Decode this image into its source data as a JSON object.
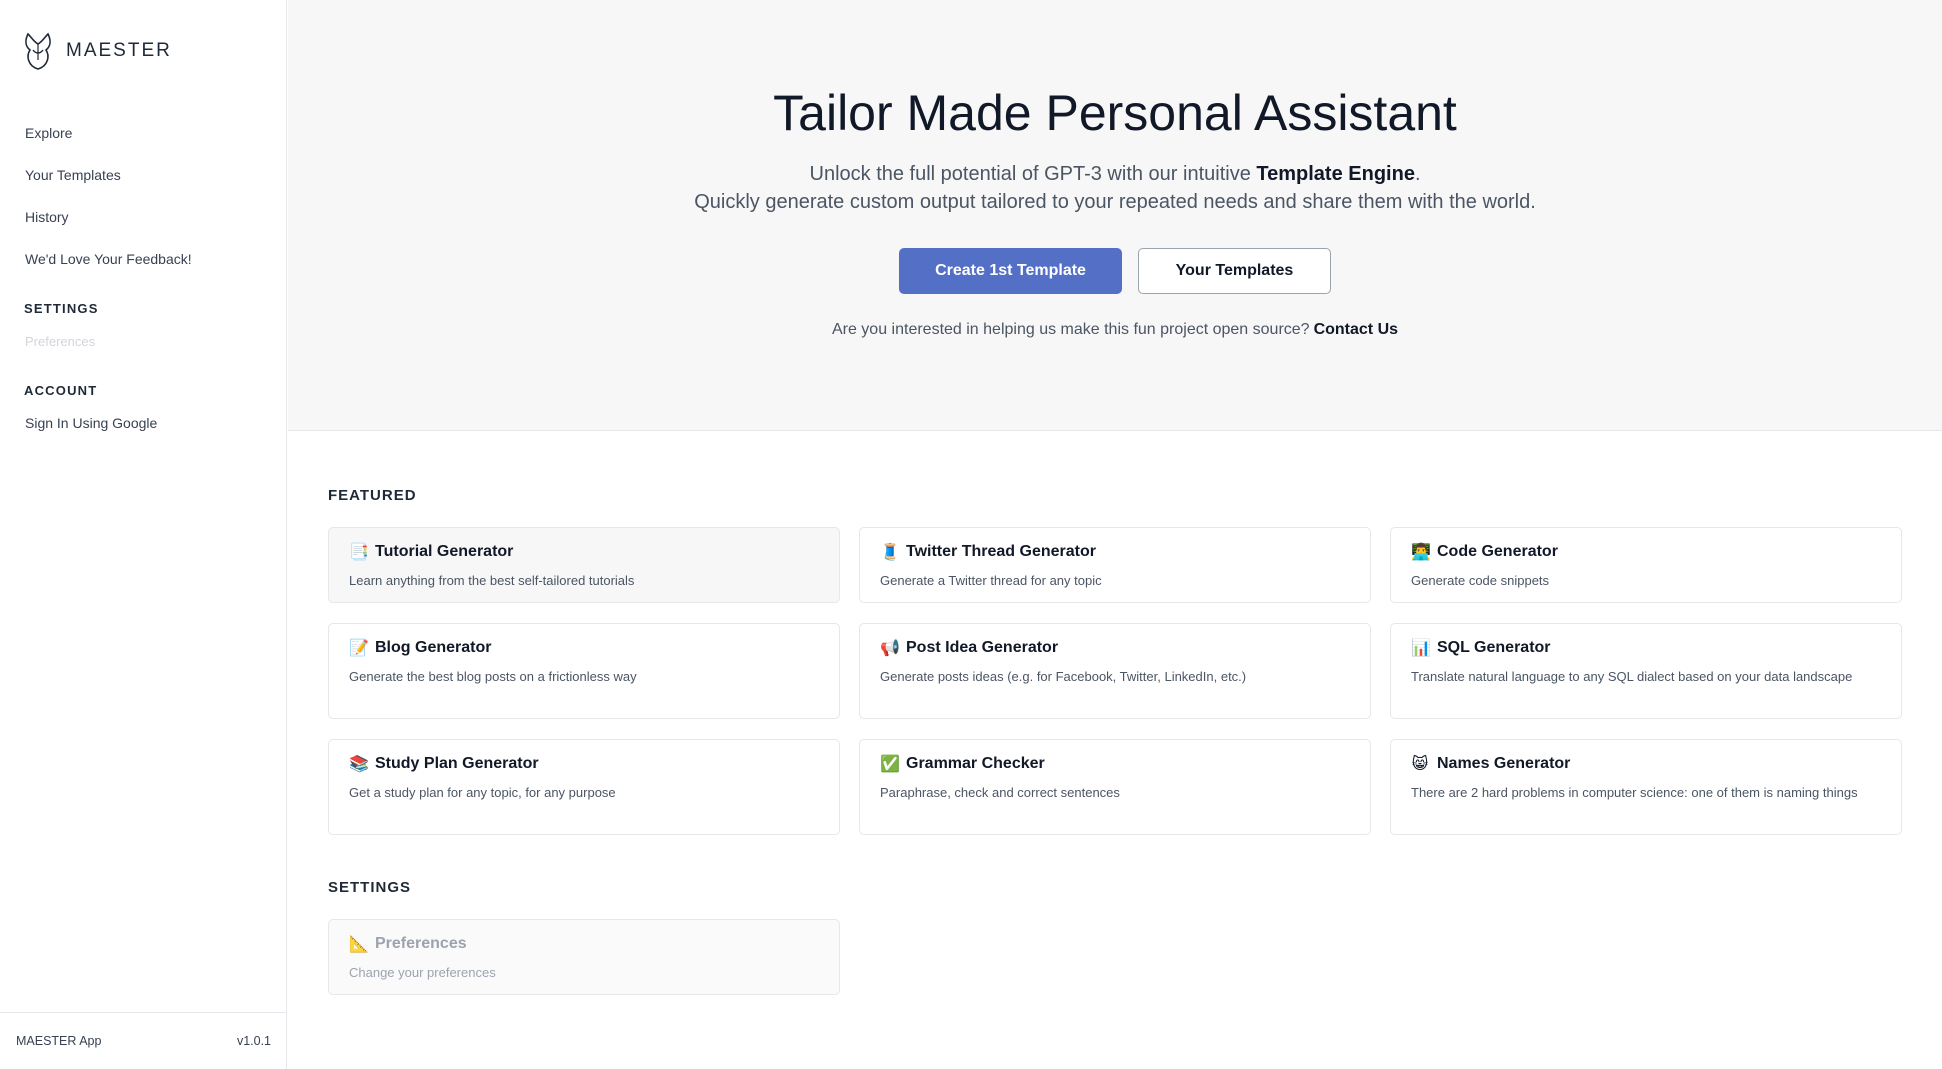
{
  "sidebar": {
    "brand": "MAESTER",
    "nav": [
      {
        "label": "Explore"
      },
      {
        "label": "Your Templates"
      },
      {
        "label": "History"
      },
      {
        "label": "We'd Love Your Feedback!"
      }
    ],
    "settings_heading": "SETTINGS",
    "settings_items": [
      {
        "label": "Preferences"
      }
    ],
    "account_heading": "ACCOUNT",
    "account_items": [
      {
        "label": "Sign In Using Google"
      }
    ],
    "footer": {
      "app_name": "MAESTER App",
      "version": "v1.0.1"
    }
  },
  "hero": {
    "title": "Tailor Made Personal Assistant",
    "subtitle_prefix": "Unlock the full potential of GPT-3 with our intuitive ",
    "subtitle_bold": "Template Engine",
    "subtitle_suffix": ".",
    "subtitle_line2": "Quickly generate custom output tailored to your repeated needs and share them with the world.",
    "primary_button": "Create 1st Template",
    "secondary_button": "Your Templates",
    "contact_prompt": "Are you interested in helping us make this fun project open source?",
    "contact_link": "Contact Us"
  },
  "featured": {
    "heading": "FEATURED",
    "cards": [
      {
        "icon": "📑",
        "title": "Tutorial Generator",
        "desc": "Learn anything from the best self-tailored tutorials"
      },
      {
        "icon": "🧵",
        "title": "Twitter Thread Generator",
        "desc": "Generate a Twitter thread for any topic"
      },
      {
        "icon": "👨‍💻",
        "title": "Code Generator",
        "desc": "Generate code snippets"
      },
      {
        "icon": "📝",
        "title": "Blog Generator",
        "desc": "Generate the best blog posts on a frictionless way"
      },
      {
        "icon": "📢",
        "title": "Post Idea Generator",
        "desc": "Generate posts ideas (e.g. for Facebook, Twitter, LinkedIn, etc.)"
      },
      {
        "icon": "📊",
        "title": "SQL Generator",
        "desc": "Translate natural language to any SQL dialect based on your data landscape"
      },
      {
        "icon": "📚",
        "title": "Study Plan Generator",
        "desc": "Get a study plan for any topic, for any purpose"
      },
      {
        "icon": "✅",
        "title": "Grammar Checker",
        "desc": "Paraphrase, check and correct sentences"
      },
      {
        "icon": "😸",
        "title": "Names Generator",
        "desc": "There are 2 hard problems in computer science: one of them is naming things"
      }
    ]
  },
  "settings": {
    "heading": "SETTINGS",
    "cards": [
      {
        "icon": "📐",
        "title": "Preferences",
        "desc": "Change your preferences"
      }
    ]
  },
  "colors": {
    "primary": "#5470c6",
    "hero_bg": "#f7f7f8",
    "border": "#e5e7eb"
  }
}
